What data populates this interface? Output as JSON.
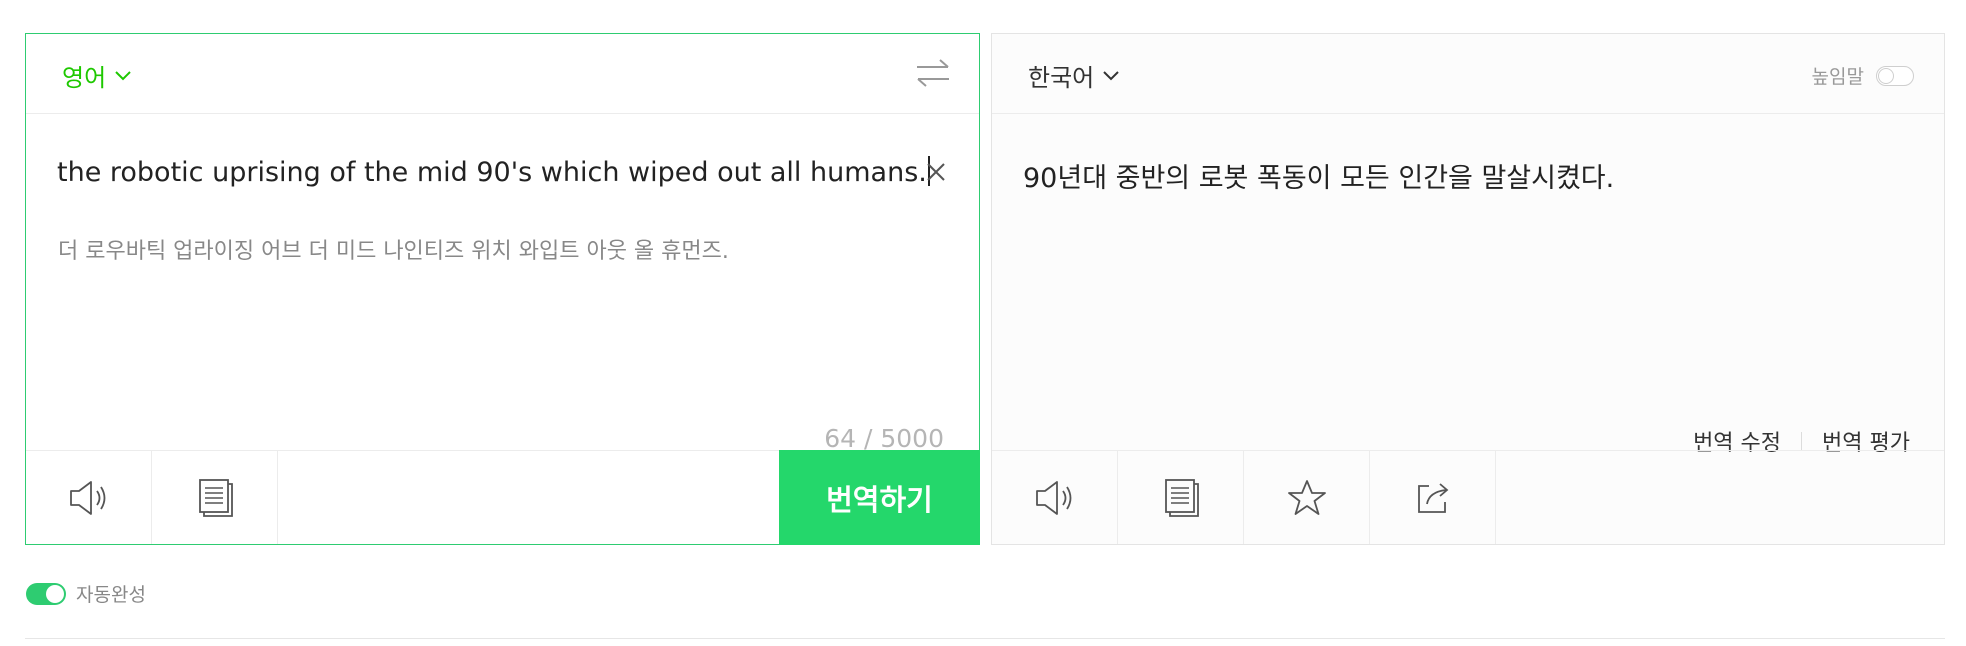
{
  "source": {
    "language": "영어",
    "text": "the robotic uprising of the mid 90's which wiped out all humans.",
    "pronunciation": "더 로우바틱 업라이징 어브 더 미드 나인티즈 위치 와입트 아웃 올 휴먼즈.",
    "char_count": "64 / 5000",
    "translate_label": "번역하기",
    "icons": [
      "chevron-down-icon",
      "swap-icon",
      "close-icon",
      "speaker-icon",
      "copy-icon"
    ]
  },
  "target": {
    "language": "한국어",
    "honorific_label": "높임말",
    "honorific_on": false,
    "text": "90년대 중반의 로봇 폭동이 모든 인간을 말살시켰다.",
    "edit_label": "번역 수정",
    "rate_label": "번역 평가",
    "icons": [
      "chevron-down-icon",
      "speaker-icon",
      "copy-icon",
      "star-icon",
      "share-icon"
    ]
  },
  "autocomplete": {
    "label": "자동완성",
    "enabled": true
  },
  "colors": {
    "accent": "#24d76b",
    "source_language": "#1ec800",
    "border_active": "#2ecc71"
  }
}
